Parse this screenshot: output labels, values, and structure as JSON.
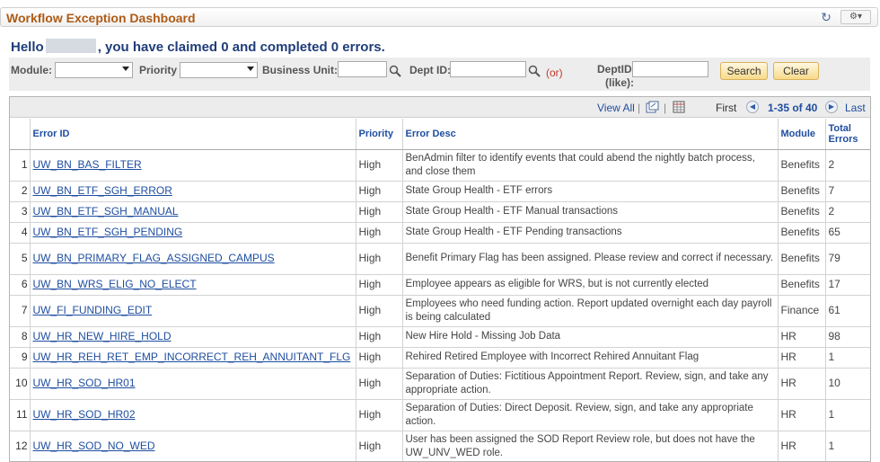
{
  "header": {
    "title": "Workflow Exception Dashboard"
  },
  "greeting": {
    "before": "Hello",
    "after": ", you have claimed 0 and completed 0 errors."
  },
  "filters": {
    "module_label": "Module:",
    "priority_label": "Priority",
    "business_unit_label": "Business Unit:",
    "dept_id_label": "Dept ID:",
    "or_label": "(or)",
    "deptid_like_label_1": "DeptID",
    "deptid_like_label_2": "(like):",
    "search_label": "Search",
    "clear_label": "Clear",
    "module_value": "",
    "priority_value": "",
    "business_unit_value": "",
    "dept_id_value": "",
    "deptid_like_value": ""
  },
  "grid_nav": {
    "view_all": "View All",
    "separator": "|",
    "first": "First",
    "range": "1-35 of 40",
    "last": "Last"
  },
  "table": {
    "columns": [
      "",
      "Error ID",
      "Priority",
      "Error Desc",
      "Module",
      "Total Errors"
    ],
    "rows": [
      {
        "n": "1",
        "id": "UW_BN_BAS_FILTER",
        "priority": "High",
        "desc": "BenAdmin filter to identify events that could abend the nightly batch process, and close them",
        "module": "Benefits",
        "total": "2"
      },
      {
        "n": "2",
        "id": "UW_BN_ETF_SGH_ERROR",
        "priority": "High",
        "desc": "State Group Health - ETF errors",
        "module": "Benefits",
        "total": "7"
      },
      {
        "n": "3",
        "id": "UW_BN_ETF_SGH_MANUAL",
        "priority": "High",
        "desc": "State Group Health - ETF Manual transactions",
        "module": "Benefits",
        "total": "2"
      },
      {
        "n": "4",
        "id": "UW_BN_ETF_SGH_PENDING",
        "priority": "High",
        "desc": "State Group Health - ETF Pending transactions",
        "module": "Benefits",
        "total": "65"
      },
      {
        "n": "5",
        "id": "UW_BN_PRIMARY_FLAG_ASSIGNED_CAMPUS",
        "priority": "High",
        "desc": "Benefit Primary Flag has been assigned. Please review and correct if necessary.",
        "module": "Benefits",
        "total": "79"
      },
      {
        "n": "6",
        "id": "UW_BN_WRS_ELIG_NO_ELECT",
        "priority": "High",
        "desc": "Employee appears as eligible for WRS, but is not currently elected",
        "module": "Benefits",
        "total": "17"
      },
      {
        "n": "7",
        "id": "UW_FI_FUNDING_EDIT",
        "priority": "High",
        "desc": "Employees who need funding action. Report updated overnight each day payroll is being calculated",
        "module": "Finance",
        "total": "61"
      },
      {
        "n": "8",
        "id": "UW_HR_NEW_HIRE_HOLD",
        "priority": "High",
        "desc": "New Hire Hold - Missing Job Data",
        "module": "HR",
        "total": "98"
      },
      {
        "n": "9",
        "id": "UW_HR_REH_RET_EMP_INCORRECT_REH_ANNUITANT_FLG",
        "priority": "High",
        "desc": "Rehired Retired Employee with Incorrect Rehired Annuitant Flag",
        "module": "HR",
        "total": "1"
      },
      {
        "n": "10",
        "id": "UW_HR_SOD_HR01",
        "priority": "High",
        "desc": "Separation of Duties: Fictitious Appointment Report. Review, sign, and take any appropriate action.",
        "module": "HR",
        "total": "10"
      },
      {
        "n": "11",
        "id": "UW_HR_SOD_HR02",
        "priority": "High",
        "desc": "Separation of Duties: Direct Deposit. Review, sign, and take any appropriate action.",
        "module": "HR",
        "total": "1"
      },
      {
        "n": "12",
        "id": "UW_HR_SOD_NO_WED",
        "priority": "High",
        "desc": "User has been assigned the SOD Report Review role, but does not have the UW_UNV_WED role.",
        "module": "HR",
        "total": "1"
      }
    ]
  },
  "colors": {
    "title": "#ae5b16",
    "link": "#1f4ea0",
    "greeting": "#1f3d7a",
    "button": "#f7d98a"
  }
}
